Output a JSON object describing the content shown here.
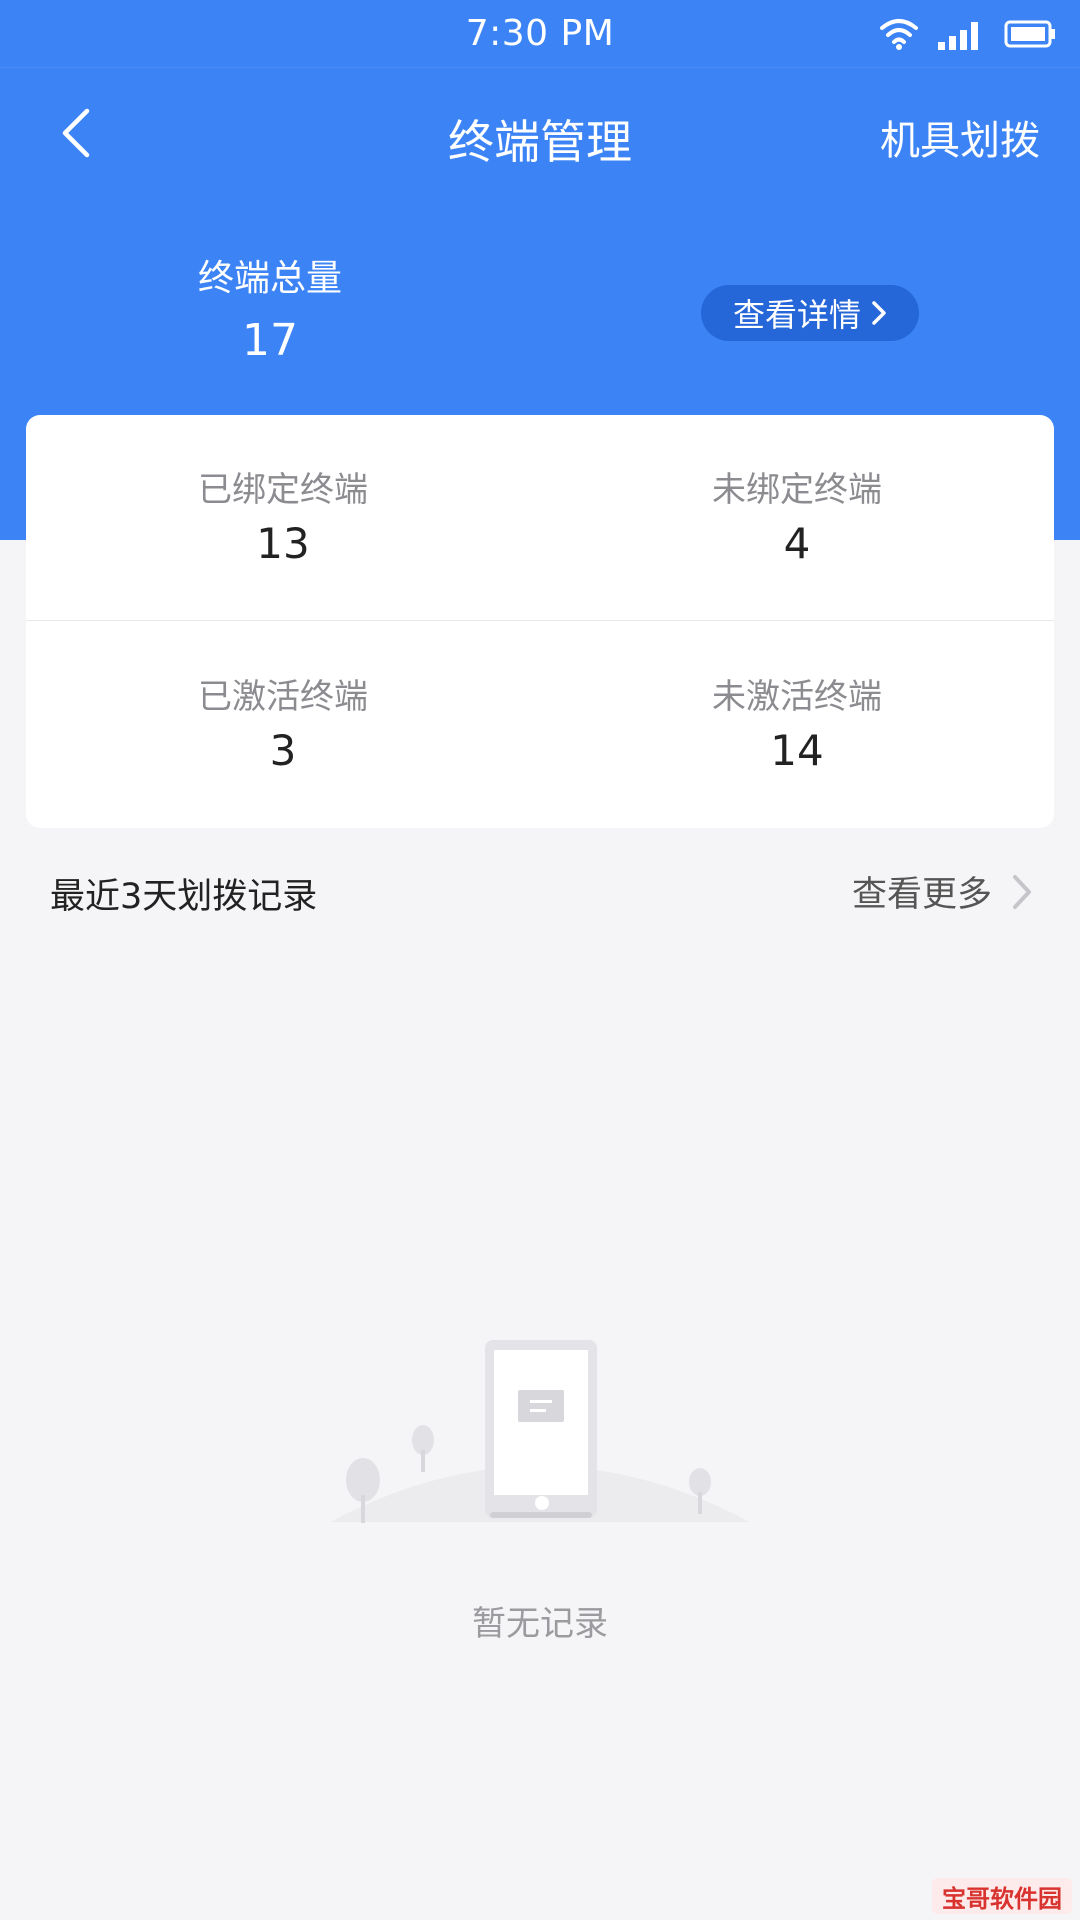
{
  "status_bar": {
    "time": "7:30 PM"
  },
  "nav": {
    "title": "终端管理",
    "action_label": "机具划拨"
  },
  "summary": {
    "total_label": "终端总量",
    "total_value": "17",
    "detail_button_label": "查看详情"
  },
  "stats": [
    {
      "label": "已绑定终端",
      "value": "13"
    },
    {
      "label": "未绑定终端",
      "value": "4"
    },
    {
      "label": "已激活终端",
      "value": "3"
    },
    {
      "label": "未激活终端",
      "value": "14"
    }
  ],
  "records": {
    "title": "最近3天划拨记录",
    "more_label": "查看更多",
    "empty_text": "暂无记录"
  },
  "watermark": {
    "text": "宝哥软件园"
  },
  "colors": {
    "header_blue": "#3c84f5",
    "button_blue": "#2566d9",
    "background": "#f5f5f7"
  },
  "icons": {
    "back": "back-arrow-icon",
    "detail_chevron": "chevron-right-icon",
    "more_chevron": "chevron-right-icon",
    "wifi": "wifi-icon",
    "signal": "signal-icon",
    "battery": "battery-icon"
  }
}
